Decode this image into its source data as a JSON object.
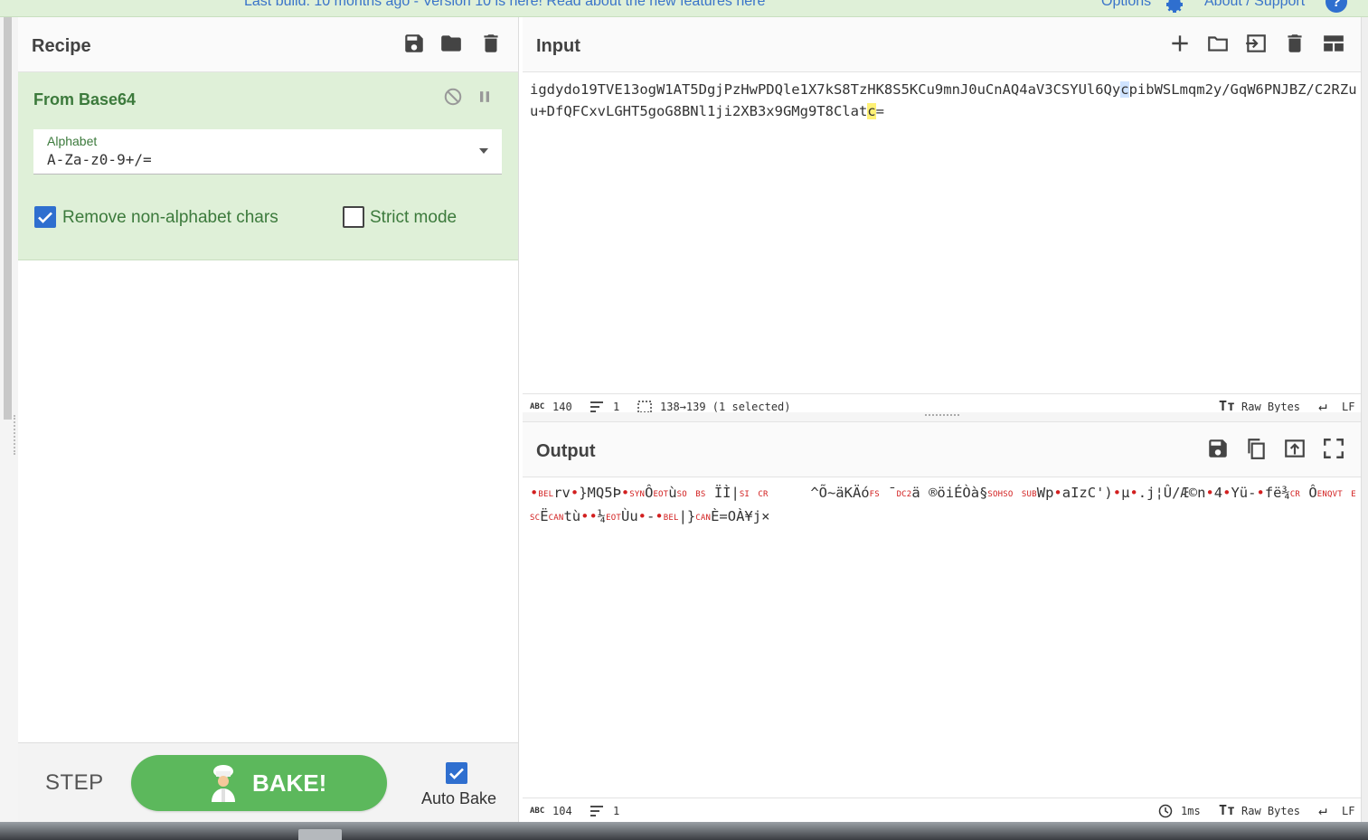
{
  "banner": {
    "notice": "Last build: 10 months ago - Version 10 is here! Read about the new features here",
    "options_label": "Options",
    "about_label": "About / Support"
  },
  "recipe": {
    "title": "Recipe",
    "operation": {
      "name": "From Base64",
      "alphabet_label": "Alphabet",
      "alphabet_value": "A-Za-z0-9+/=",
      "remove_non_alpha_label": "Remove non-alphabet chars",
      "remove_non_alpha_checked": true,
      "strict_mode_label": "Strict mode",
      "strict_mode_checked": false
    },
    "step_label": "STEP",
    "bake_label": "BAKE!",
    "auto_bake_label": "Auto Bake",
    "auto_bake_checked": true
  },
  "input": {
    "title": "Input",
    "text_part1": "igdydo19TVE13ogW1AT5DgjPzHwPDQle1X7kS8TzHK8S5KCu9mnJ0uCnAQ4aV3CSYUl6Qy",
    "text_sel": "c",
    "text_part2": "pibWSLmqm2y/GqW6PNJBZ/C2RZuu+DfQFCxvLGHT5goG8BNl1ji2XB3x9GMg9T8Clat",
    "text_cur": "c",
    "text_part3": "=",
    "status": {
      "length": "140",
      "lines": "1",
      "selection": "138→139 (1 selected)",
      "encoding": "Raw Bytes",
      "eol": "LF"
    }
  },
  "output": {
    "title": "Output",
    "status": {
      "length": "104",
      "lines": "1",
      "time": "1ms",
      "encoding": "Raw Bytes",
      "eol": "LF"
    }
  },
  "colors": {
    "accent_blue": "#2f6fcf",
    "recipe_green_bg": "#dff0d8",
    "bake_green": "#5cb85c",
    "label_green": "#3c7a3c",
    "control_char_red": "#d21f1f"
  }
}
